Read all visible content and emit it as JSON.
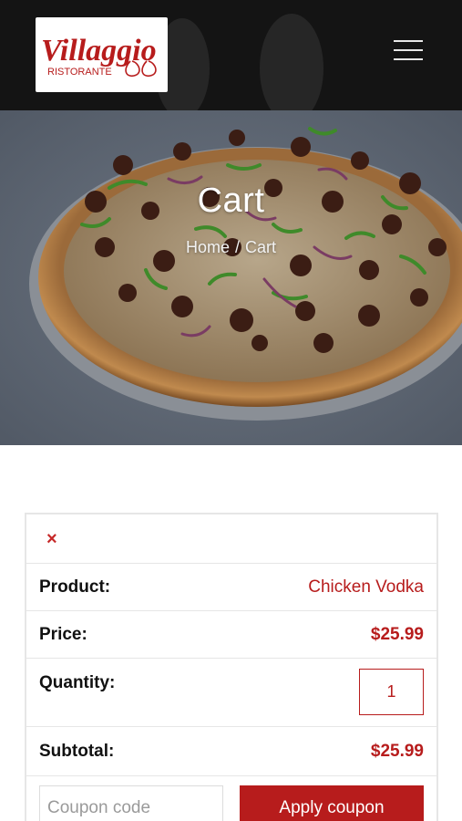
{
  "brand": {
    "logo_name": "Villaggio",
    "logo_sub": "RISTORANTE",
    "logo_color": "#b71c1c"
  },
  "hero": {
    "title": "Cart",
    "breadcrumb": {
      "home": "Home",
      "separator": "/",
      "current": "Cart"
    }
  },
  "cart": {
    "remove_icon": "×",
    "product": {
      "label": "Product:",
      "value": "Chicken Vodka"
    },
    "price": {
      "label": "Price:",
      "value": "$25.99"
    },
    "quantity": {
      "label": "Quantity:",
      "value": "1"
    },
    "subtotal": {
      "label": "Subtotal:",
      "value": "$25.99"
    },
    "coupon": {
      "placeholder": "Coupon code",
      "button": "Apply coupon"
    }
  },
  "colors": {
    "accent": "#b71c1c",
    "header_bg": "#141414",
    "border": "#e6e6e6"
  }
}
